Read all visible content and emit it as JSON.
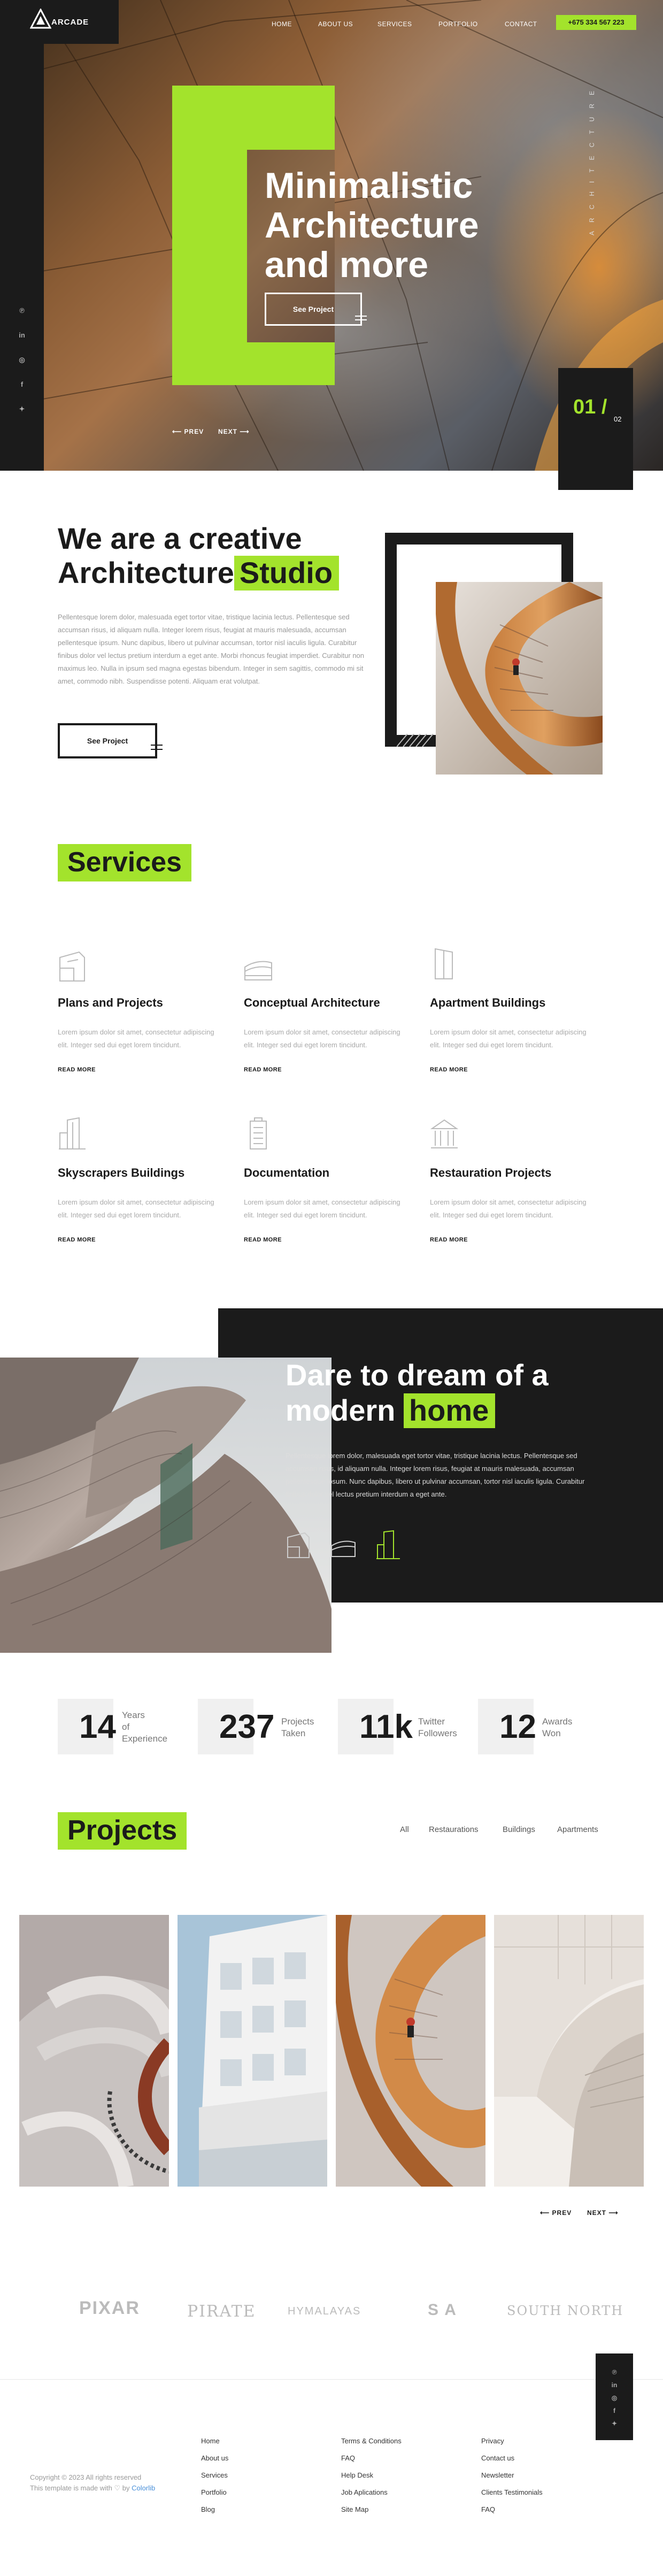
{
  "brand": {
    "name": "ARCADE"
  },
  "nav": {
    "items": [
      "HOME",
      "ABOUT US",
      "SERVICES",
      "PORTFOLIO",
      "CONTACT"
    ],
    "phone": "+675 334 567 223"
  },
  "social": [
    "pinterest",
    "linkedin",
    "instagram",
    "facebook",
    "twitter"
  ],
  "hero": {
    "title_lines": [
      "Minimalistic",
      "Architecture",
      "and more"
    ],
    "button": "See Project",
    "prev": "PREV",
    "next": "NEXT",
    "vertical_text": "ARCHITECTURE",
    "counter_current": "01 /",
    "counter_total": "02"
  },
  "about": {
    "title_line1": "We are a creative",
    "title_line2": "Architecture",
    "title_highlight": "Studio",
    "paragraph": "Pellentesque lorem dolor, malesuada eget tortor vitae, tristique lacinia lectus. Pellentesque sed accumsan risus, id aliquam nulla. Integer lorem risus, feugiat at mauris malesuada, accumsan pellentesque ipsum. Nunc dapibus, libero ut pulvinar accumsan, tortor nisl iaculis ligula. Curabitur finibus dolor vel lectus pretium interdum a eget ante. Morbi rhoncus feugiat imperdiet. Curabitur non maximus leo. Nulla in ipsum sed magna egestas bibendum. Integer in sem sagittis, commodo mi sit amet, commodo nibh. Suspendisse potenti. Aliquam erat volutpat.",
    "button": "See Project"
  },
  "services": {
    "title": "Services",
    "items": [
      {
        "icon": "house-plan-icon",
        "title": "Plans and Projects",
        "text": "Lorem ipsum dolor sit amet, consectetur adipiscing elit. Integer sed dui eget lorem tincidunt.",
        "more": "READ MORE"
      },
      {
        "icon": "conceptual-building-icon",
        "title": "Conceptual Architecture",
        "text": "Lorem ipsum dolor sit amet, consectetur adipiscing elit. Integer sed dui eget lorem tincidunt.",
        "more": "READ MORE"
      },
      {
        "icon": "apartment-building-icon",
        "title": "Apartment Buildings",
        "text": "Lorem ipsum dolor sit amet, consectetur adipiscing elit. Integer sed dui eget lorem tincidunt.",
        "more": "READ MORE"
      },
      {
        "icon": "skyscraper-icon",
        "title": "Skyscrapers Buildings",
        "text": "Lorem ipsum dolor sit amet, consectetur adipiscing elit. Integer sed dui eget lorem tincidunt.",
        "more": "READ MORE"
      },
      {
        "icon": "document-icon",
        "title": "Documentation",
        "text": "Lorem ipsum dolor sit amet, consectetur adipiscing elit. Integer sed dui eget lorem tincidunt.",
        "more": "READ MORE"
      },
      {
        "icon": "classic-building-icon",
        "title": "Restauration Projects",
        "text": "Lorem ipsum dolor sit amet, consectetur adipiscing elit. Integer sed dui eget lorem tincidunt.",
        "more": "READ MORE"
      }
    ]
  },
  "dream": {
    "title_line1": "Dare to dream of a",
    "title_line2": "modern",
    "title_highlight": "home",
    "paragraph": "Pellentesque lorem dolor, malesuada eget tortor vitae, tristique lacinia lectus. Pellentesque sed accumsan risus, id aliquam nulla. Integer lorem risus, feugiat at mauris malesuada, accumsan pellentesque ipsum. Nunc dapibus, libero ut pulvinar accumsan, tortor nisl iaculis ligula. Curabitur finibus dolor vel lectus pretium interdum a eget ante."
  },
  "stats": [
    {
      "value": "14",
      "label": "Years of Experience",
      "lines": [
        "Years",
        "of",
        "Experience"
      ]
    },
    {
      "value": "237",
      "label": "Projects Taken",
      "lines": [
        "Projects",
        "Taken"
      ]
    },
    {
      "value": "11k",
      "label": "Twitter Followers",
      "lines": [
        "Twitter",
        "Followers"
      ]
    },
    {
      "value": "12",
      "label": "Awards Won",
      "lines": [
        "Awards",
        "Won"
      ]
    }
  ],
  "projects": {
    "title": "Projects",
    "filters": [
      "All",
      "Restaurations",
      "Buildings",
      "Apartments"
    ],
    "prev": "PREV",
    "next": "NEXT"
  },
  "clients": [
    "PIXAR",
    "PIRATE",
    "HYMALAYAS",
    "S A",
    "SOUTH NORTH"
  ],
  "footer": {
    "col1": [
      "Home",
      "About us",
      "Services",
      "Portfolio",
      "Blog"
    ],
    "col2": [
      "Terms & Conditions",
      "FAQ",
      "Help Desk",
      "Job Aplications",
      "Site Map"
    ],
    "col3": [
      "Privacy",
      "Contact us",
      "Newsletter",
      "Clients Testimonials",
      "FAQ"
    ],
    "copyright": "Copyright © 2023 All rights reserved",
    "made_prefix": "This template is made with ♡ by",
    "made_link": "Colorlib"
  },
  "colors": {
    "accent": "#a3e32c",
    "dark": "#1b1b1b"
  }
}
